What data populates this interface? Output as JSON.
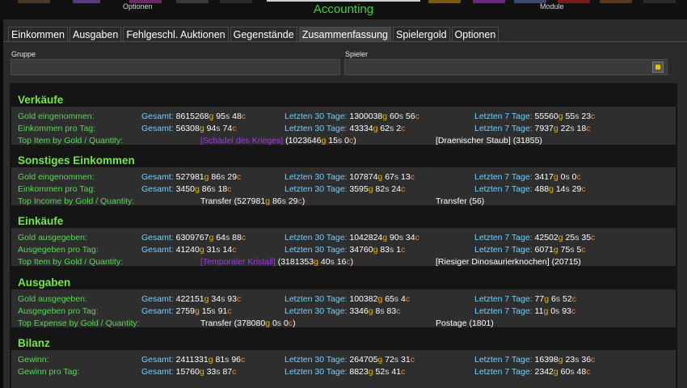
{
  "header": {
    "title": "Accounting",
    "optionen_label": "Optionen",
    "module_label": "Module"
  },
  "tabs": [
    {
      "label": "Einkommen",
      "active": false
    },
    {
      "label": "Ausgaben",
      "active": false
    },
    {
      "label": "Fehlgeschl. Auktionen",
      "active": false
    },
    {
      "label": "Gegenstände",
      "active": false
    },
    {
      "label": "Zusammenfassung",
      "active": true
    },
    {
      "label": "Spielergold",
      "active": false
    },
    {
      "label": "Optionen",
      "active": false
    }
  ],
  "filters": {
    "group_label": "Gruppe",
    "player_label": "Spieler",
    "group_value": "",
    "player_value": ""
  },
  "sections": [
    {
      "title": "Verkäufe",
      "rows": [
        {
          "label": "Gold eingenommen:",
          "cols": [
            {
              "prefix": "Gesamt: ",
              "g": "8615268",
              "s": "95",
              "c": "48"
            },
            {
              "prefix": "Letzten 30 Tage: ",
              "g": "1300038",
              "s": "60",
              "c": "56"
            },
            {
              "prefix": "Letzten 7 Tage: ",
              "g": "55560",
              "s": "55",
              "c": "23"
            }
          ]
        },
        {
          "label": "Einkommen pro Tag:",
          "cols": [
            {
              "prefix": "Gesamt: ",
              "g": "56308",
              "s": "94",
              "c": "74"
            },
            {
              "prefix": "Letzten 30 Tage: ",
              "g": "43334",
              "s": "62",
              "c": "2"
            },
            {
              "prefix": "Letzten 7 Tage: ",
              "g": "7937",
              "s": "22",
              "c": "18"
            }
          ]
        }
      ],
      "top": {
        "label": "Top Item by Gold / Quantity:",
        "item": "[Schädel des Krieges]",
        "g": "1023646",
        "s": "15",
        "c": "0",
        "qty_text": "[Draenischer Staub] (31855)",
        "item_is_link": true
      }
    },
    {
      "title": "Sonstiges Einkommen",
      "rows": [
        {
          "label": "Gold eingenommen:",
          "cols": [
            {
              "prefix": "Gesamt: ",
              "g": "527981",
              "s": "86",
              "c": "29"
            },
            {
              "prefix": "Letzten 30 Tage: ",
              "g": "107874",
              "s": "67",
              "c": "13"
            },
            {
              "prefix": "Letzten 7 Tage: ",
              "g": "3417",
              "s": "0",
              "c": "0"
            }
          ]
        },
        {
          "label": "Einkommen pro Tag:",
          "cols": [
            {
              "prefix": "Gesamt: ",
              "g": "3450",
              "s": "86",
              "c": "18"
            },
            {
              "prefix": "Letzten 30 Tage: ",
              "g": "3595",
              "s": "82",
              "c": "24"
            },
            {
              "prefix": "Letzten 7 Tage: ",
              "g": "488",
              "s": "14",
              "c": "29"
            }
          ]
        }
      ],
      "top": {
        "label": "Top Income by Gold / Quantity:",
        "item": "Transfer",
        "g": "527981",
        "s": "86",
        "c": "29",
        "qty_text": "Transfer (56)",
        "item_is_link": false
      }
    },
    {
      "title": "Einkäufe",
      "rows": [
        {
          "label": "Gold ausgegeben:",
          "cols": [
            {
              "prefix": "Gesamt: ",
              "g": "6309767",
              "s": "64",
              "c": "88"
            },
            {
              "prefix": "Letzten 30 Tage: ",
              "g": "1042824",
              "s": "90",
              "c": "34"
            },
            {
              "prefix": "Letzten 7 Tage: ",
              "g": "42502",
              "s": "25",
              "c": "35"
            }
          ]
        },
        {
          "label": "Ausgegeben pro Tag:",
          "cols": [
            {
              "prefix": "Gesamt: ",
              "g": "41240",
              "s": "31",
              "c": "14"
            },
            {
              "prefix": "Letzten 30 Tage: ",
              "g": "34760",
              "s": "83",
              "c": "1"
            },
            {
              "prefix": "Letzten 7 Tage: ",
              "g": "6071",
              "s": "75",
              "c": "5"
            }
          ]
        }
      ],
      "top": {
        "label": "Top Item by Gold / Quantity:",
        "item": "[Temporaler Kristall]",
        "g": "3181353",
        "s": "40",
        "c": "16",
        "qty_text": "[Riesiger Dinosaurierknochen] (20715)",
        "item_is_link": true
      }
    },
    {
      "title": "Ausgaben",
      "rows": [
        {
          "label": "Gold ausgegeben:",
          "cols": [
            {
              "prefix": "Gesamt: ",
              "g": "422151",
              "s": "34",
              "c": "93"
            },
            {
              "prefix": "Letzten 30 Tage: ",
              "g": "100382",
              "s": "65",
              "c": "4"
            },
            {
              "prefix": "Letzten 7 Tage: ",
              "g": "77",
              "s": "6",
              "c": "52"
            }
          ]
        },
        {
          "label": "Ausgegeben pro Tag:",
          "cols": [
            {
              "prefix": "Gesamt: ",
              "g": "2759",
              "s": "15",
              "c": "91"
            },
            {
              "prefix": "Letzten 30 Tage: ",
              "g": "3346",
              "s": "8",
              "c": "83"
            },
            {
              "prefix": "Letzten 7 Tage: ",
              "g": "11",
              "s": "0",
              "c": "93"
            }
          ]
        }
      ],
      "top": {
        "label": "Top Expense by Gold / Quantity:",
        "item": "Transfer",
        "g": "378080",
        "s": "0",
        "c": "0",
        "qty_text": "Postage (1801)",
        "item_is_link": false
      }
    },
    {
      "title": "Bilanz",
      "rows": [
        {
          "label": "Gewinn:",
          "cols": [
            {
              "prefix": "Gesamt: ",
              "g": "2411331",
              "s": "81",
              "c": "96"
            },
            {
              "prefix": "Letzten 30 Tage: ",
              "g": "264705",
              "s": "72",
              "c": "31"
            },
            {
              "prefix": "Letzten 7 Tage: ",
              "g": "16398",
              "s": "23",
              "c": "36"
            }
          ]
        },
        {
          "label": "Gewinn pro Tag:",
          "cols": [
            {
              "prefix": "Gesamt: ",
              "g": "15760",
              "s": "33",
              "c": "87"
            },
            {
              "prefix": "Letzten 30 Tage: ",
              "g": "8823",
              "s": "52",
              "c": "41"
            },
            {
              "prefix": "Letzten 7 Tage: ",
              "g": "2342",
              "s": "60",
              "c": "48"
            }
          ]
        }
      ],
      "top": null
    }
  ],
  "currency": {
    "gold": "g",
    "silver": "s",
    "copper": "c"
  }
}
